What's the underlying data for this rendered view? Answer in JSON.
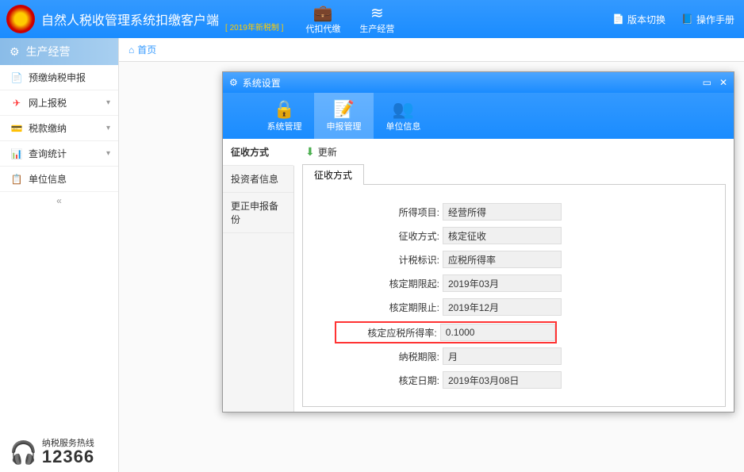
{
  "header": {
    "title": "自然人税收管理系统扣缴客户端",
    "subtitle": "[ 2019年新税制 ]",
    "icons": [
      {
        "label": "代扣代缴"
      },
      {
        "label": "生产经营"
      }
    ],
    "right": [
      {
        "label": "版本切换"
      },
      {
        "label": "操作手册"
      }
    ]
  },
  "sidebar": {
    "header": "生产经营",
    "items": [
      {
        "label": "预缴纳税申报"
      },
      {
        "label": "网上报税"
      },
      {
        "label": "税款缴纳"
      },
      {
        "label": "查询统计"
      },
      {
        "label": "单位信息"
      }
    ]
  },
  "breadcrumb": {
    "home": "首页"
  },
  "modal": {
    "title": "系统设置",
    "tabs": [
      {
        "label": "系统管理"
      },
      {
        "label": "申报管理"
      },
      {
        "label": "单位信息"
      }
    ],
    "side": [
      {
        "label": "征收方式"
      },
      {
        "label": "投资者信息"
      },
      {
        "label": "更正申报备份"
      }
    ],
    "update": "更新",
    "innerTab": "征收方式",
    "form": {
      "f0": {
        "label": "所得项目:",
        "value": "经营所得"
      },
      "f1": {
        "label": "征收方式:",
        "value": "核定征收"
      },
      "f2": {
        "label": "计税标识:",
        "value": "应税所得率"
      },
      "f3": {
        "label": "核定期限起:",
        "value": "2019年03月"
      },
      "f4": {
        "label": "核定期限止:",
        "value": "2019年12月"
      },
      "f5": {
        "label": "核定应税所得率:",
        "value": "0.1000"
      },
      "f6": {
        "label": "纳税期限:",
        "value": "月"
      },
      "f7": {
        "label": "核定日期:",
        "value": "2019年03月08日"
      }
    }
  },
  "hotline": {
    "label": "纳税服务热线",
    "number": "12366"
  }
}
